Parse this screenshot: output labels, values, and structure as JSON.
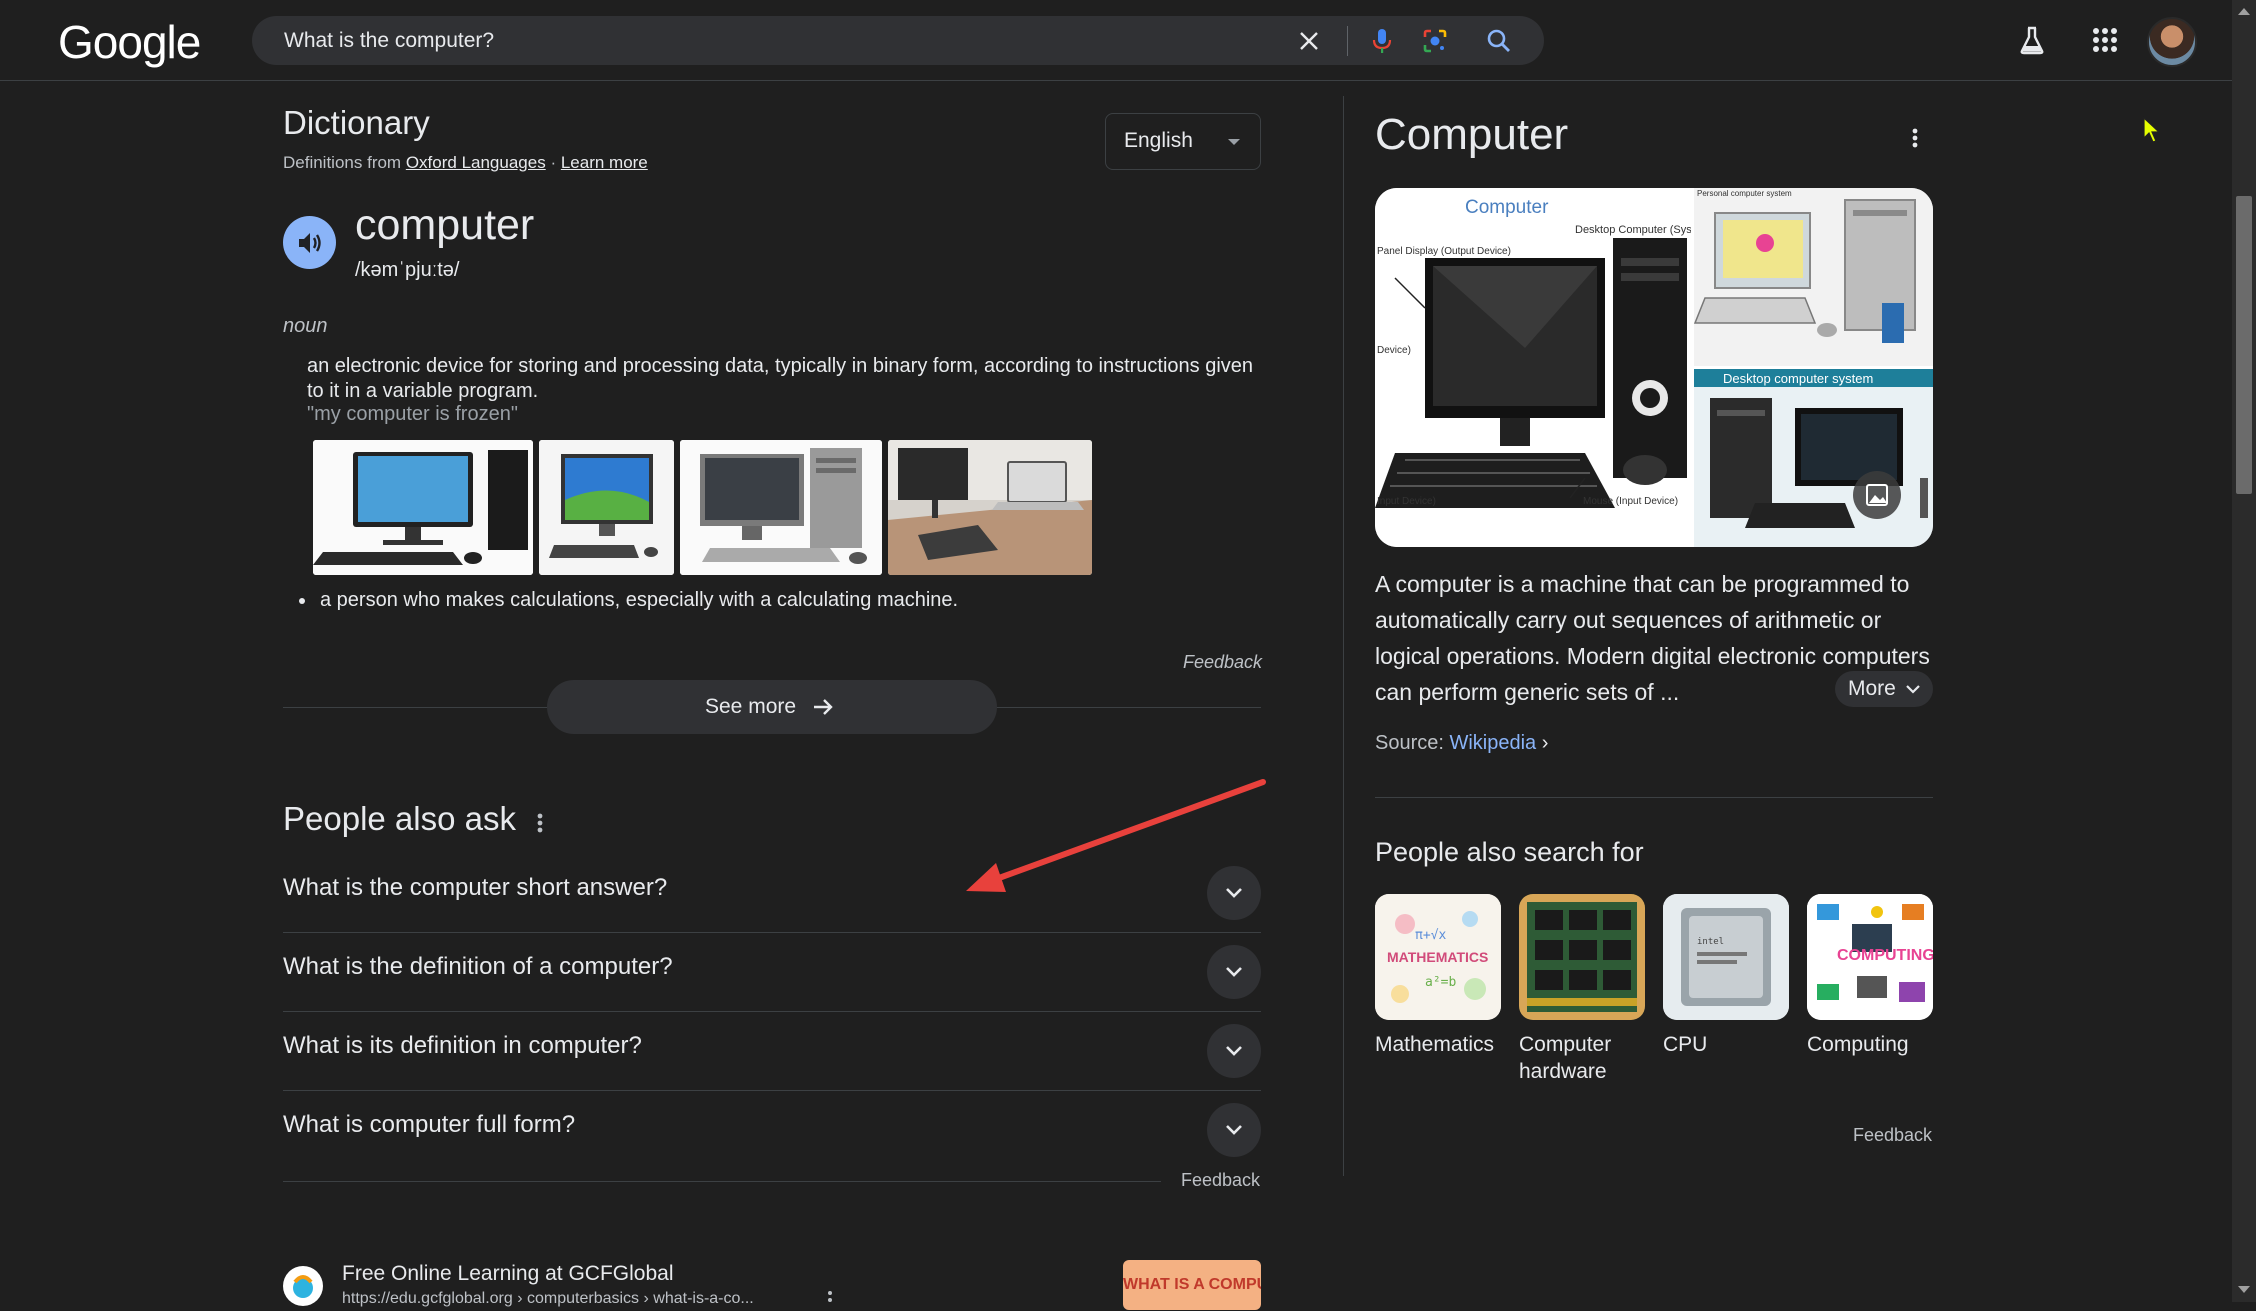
{
  "header": {
    "logo": "Google",
    "search": {
      "value": "What is the computer?",
      "placeholder": ""
    },
    "icons": [
      "close-icon",
      "microphone-icon",
      "lens-icon",
      "search-icon",
      "labs-flask-icon",
      "apps-grid-icon",
      "avatar"
    ]
  },
  "dictionary": {
    "title": "Dictionary",
    "source_prefix": "Definitions from ",
    "source_link": "Oxford Languages",
    "source_sep": " · ",
    "learn_more": "Learn more",
    "language": "English",
    "word": "computer",
    "phonetic": "/kəmˈpjuːtə/",
    "part_of_speech": "noun",
    "definition_1": "an electronic device for storing and processing data, typically in binary form, according to instructions given to it in a variable program.",
    "example_1": "\"my computer is frozen\"",
    "definition_2": "a person who makes calculations, especially with a calculating machine.",
    "feedback": "Feedback",
    "see_more": "See more"
  },
  "people_also_ask": {
    "title": "People also ask",
    "questions": [
      "What is the computer short answer?",
      "What is the definition of a computer?",
      "What is its definition in computer?",
      "What is computer full form?"
    ],
    "feedback": "Feedback"
  },
  "result": {
    "site": "Free Online Learning at GCFGlobal",
    "url": "https://edu.gcfglobal.org › computerbasics › what-is-a-co...",
    "thumb_text": "WHAT IS A COMPUTER"
  },
  "knowledge_panel": {
    "title": "Computer",
    "image_labels": {
      "computer": "Computer",
      "desktop_computer": "Desktop Computer (Syst",
      "panel_display": "Panel Display (Output Device)",
      "device": "Device)",
      "input_device": "Input Device)",
      "mouse": "Mouse (Input Device)",
      "personal_system": "Personal computer system",
      "desktop_system": "Desktop computer system"
    },
    "description": "A computer is a machine that can be programmed to automatically carry out sequences of arithmetic or logical operations. Modern digital electronic computers can perform generic sets of ...",
    "more": "More",
    "source_label": "Source: ",
    "source_link": "Wikipedia",
    "people_also_search_title": "People also search for",
    "people_also_search": [
      {
        "label": "Mathematics"
      },
      {
        "label": "Computer hardware"
      },
      {
        "label": "CPU"
      },
      {
        "label": "Computing"
      }
    ],
    "feedback": "Feedback"
  },
  "colors": {
    "background": "#1f1f1f",
    "surface": "#303134",
    "text": "#e8eaed",
    "muted": "#bdc1c6",
    "link": "#8ab4f8",
    "annotation_arrow": "#e8413c"
  }
}
